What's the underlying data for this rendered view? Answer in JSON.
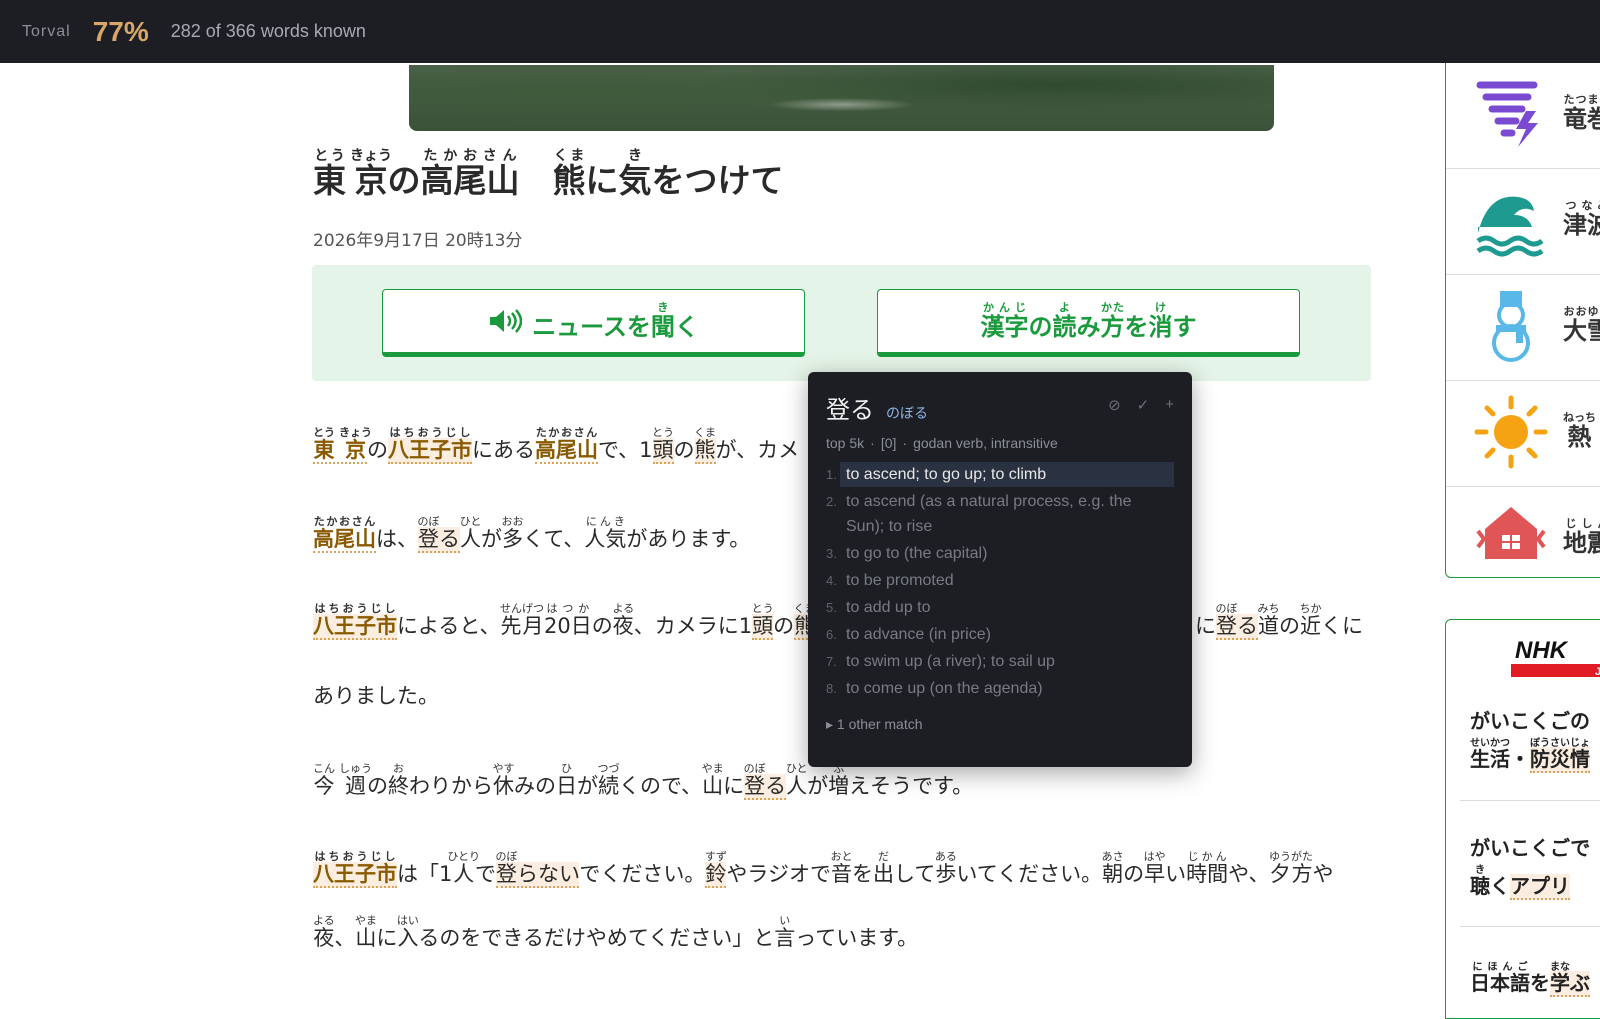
{
  "topbar": {
    "brand": "Torval",
    "percent": "77%",
    "known": "282 of 366 words known"
  },
  "article": {
    "date": "2026年9月17日 20時13分"
  },
  "buttons": {
    "listen_tail": "ニュースを",
    "listen_kanji": "聞",
    "listen_kanji_ruby": "き",
    "listen_end": "く",
    "hide_kanji_label": "漢字の読み方を消す"
  },
  "popup": {
    "word": "登る",
    "reading": "のぼる",
    "freq": "top 5k",
    "index": "[0]",
    "pos": "godan verb, intransitive",
    "glosses": [
      "to ascend; to go up; to climb",
      "to ascend (as a natural process, e.g. the Sun); to rise",
      "to go to (the capital)",
      "to be promoted",
      "to add up to",
      "to advance (in price)",
      "to swim up (a river); to sail up",
      "to come up (on the agenda)"
    ],
    "other_matches": "▸ 1 other match",
    "action_icons": [
      "ban-icon",
      "check-icon",
      "plus-icon"
    ]
  },
  "sidebar": {
    "hazards": [
      {
        "icon": "tornado-icon",
        "label": "竜巻",
        "ruby": "たつまき"
      },
      {
        "icon": "tsunami-icon",
        "label": "津波",
        "ruby": "つなみ"
      },
      {
        "icon": "snowman-icon",
        "label": "大雪",
        "ruby": "おおゆき"
      },
      {
        "icon": "sun-icon",
        "label": "熱",
        "ruby": "ねっち"
      },
      {
        "icon": "earthquake-house-icon",
        "label": "地震",
        "ruby": "じしん"
      }
    ],
    "promo": {
      "line1": "がいこくごの",
      "line3": "がいこくごで"
    }
  },
  "colors": {
    "accent_green": "#1a9a3c",
    "topbar_bg": "#1c1e23",
    "percent": "#d9a66a",
    "known_word_brown": "#8a5a00"
  }
}
